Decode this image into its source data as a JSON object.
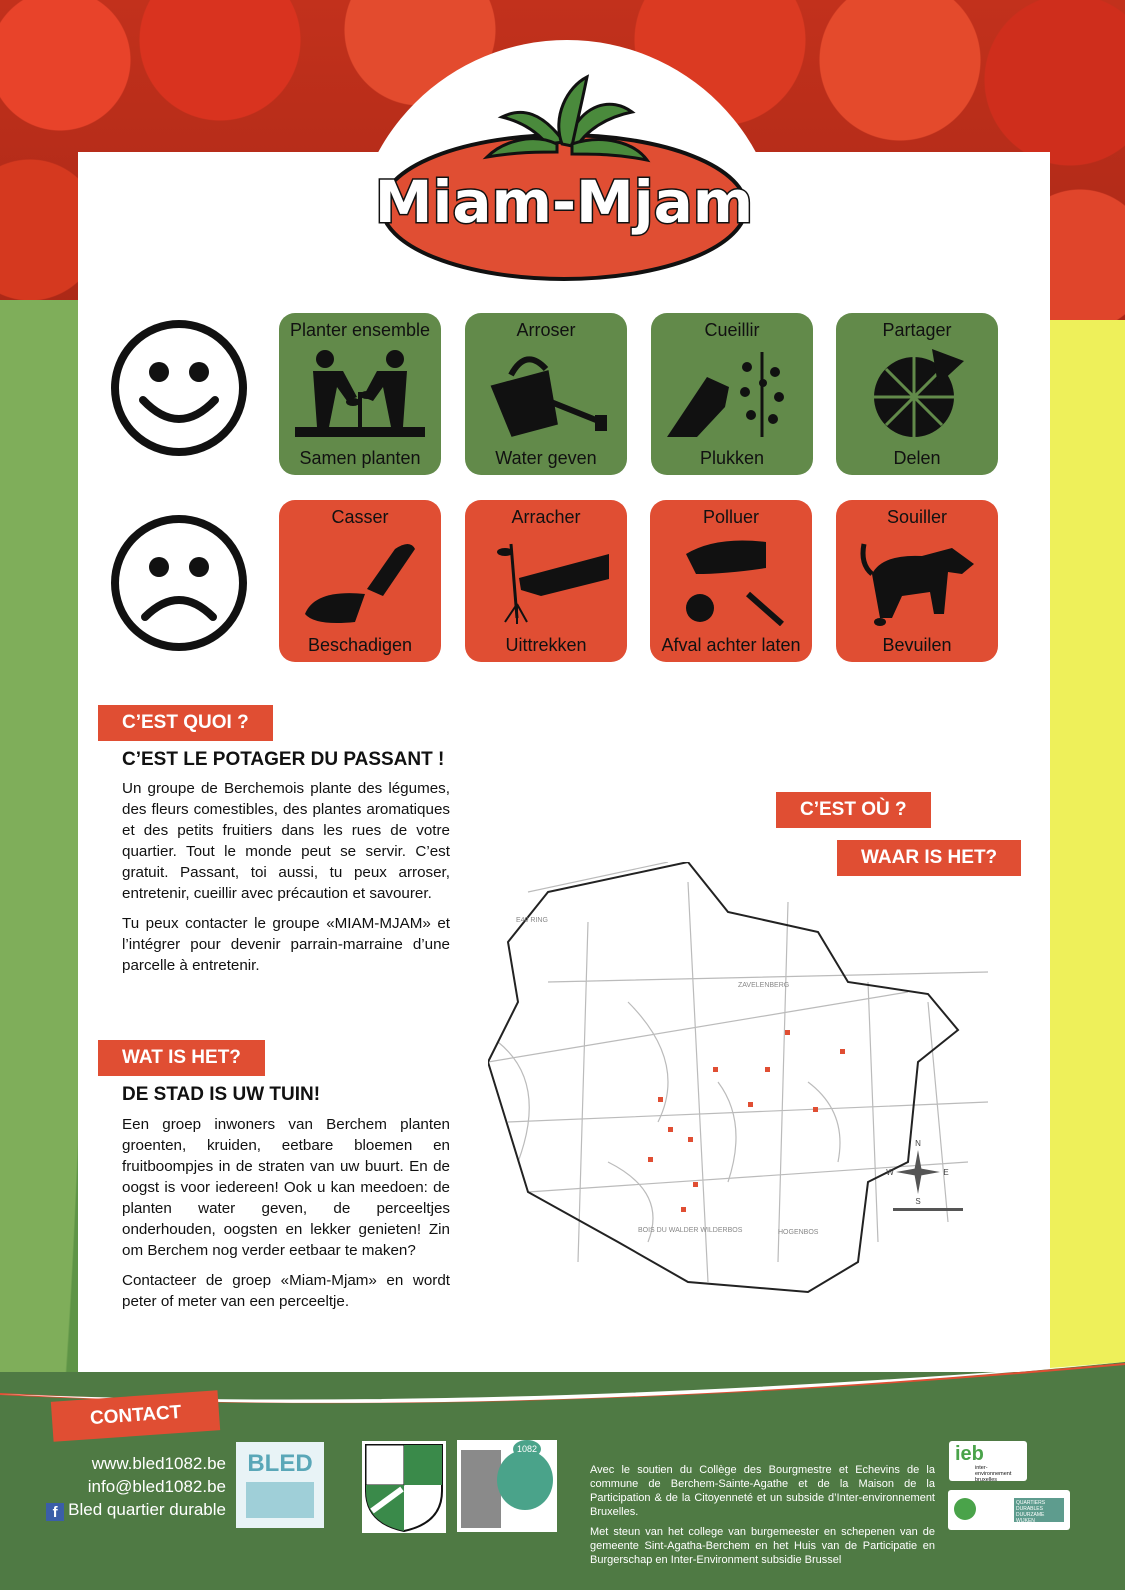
{
  "logo": {
    "text": "Miam-Mjam"
  },
  "do_row": [
    {
      "top": "Planter ensemble",
      "bottom": "Samen planten",
      "icon": "planting-icon"
    },
    {
      "top": "Arroser",
      "bottom": "Water geven",
      "icon": "watering-can-icon"
    },
    {
      "top": "Cueillir",
      "bottom": "Plukken",
      "icon": "picking-icon"
    },
    {
      "top": "Partager",
      "bottom": "Delen",
      "icon": "pizza-icon"
    }
  ],
  "dont_row": [
    {
      "top": "Casser",
      "bottom": "Beschadigen",
      "icon": "broken-zucchini-icon"
    },
    {
      "top": "Arracher",
      "bottom": "Uittrekken",
      "icon": "uprooting-icon"
    },
    {
      "top": "Polluer",
      "bottom": "Afval achter laten",
      "icon": "littering-icon"
    },
    {
      "top": "Souiller",
      "bottom": "Bevuilen",
      "icon": "dog-fouling-icon"
    }
  ],
  "fr": {
    "tag": "C’EST QUOI ?",
    "title": "C’EST LE POTAGER DU PASSANT !",
    "p1": "Un groupe de Berchemois plante des légumes, des fleurs comestibles, des plantes aromatiques et des petits fruitiers dans les rues de votre quartier. Tout le monde peut se servir. C’est gratuit. Passant, toi aussi, tu peux arroser, entretenir, cueillir avec précaution et savourer.",
    "p2": "Tu peux contacter le groupe «MIAM-MJAM» et l’intégrer pour devenir parrain-marraine d’une parcelle à entretenir."
  },
  "nl": {
    "tag": "WAT IS HET?",
    "title": "DE STAD IS UW TUIN!",
    "p1": "Een groep inwoners van Berchem planten groenten, kruiden, eetbare bloemen en fruitboompjes in de straten van uw buurt. En de oogst is voor iedereen! Ook u kan meedoen: de planten water geven, de perceeltjes onderhouden, oogsten en lekker genieten! Zin om Berchem nog verder eetbaar te maken?",
    "p2": "Contacteer de groep «Miam-Mjam» en wordt peter of meter van een perceeltje."
  },
  "where": {
    "fr": "C’EST OÙ ?",
    "nl": "WAAR IS HET?"
  },
  "map_labels": {
    "e40": "E40 RING",
    "zavelenberg": "ZAVELENBERG",
    "bois": "BOIS DU WALDER WILDERBOS",
    "hogenbos": "HOGENBOS",
    "compass_n": "N",
    "compass_s": "S",
    "compass_e": "E",
    "compass_w": "W"
  },
  "footer": {
    "contact_tag": "CONTACT",
    "web": "www.bled1082.be",
    "email": "info@bled1082.be",
    "facebook": "Bled quartier durable",
    "bled_logo": "BLED",
    "maison_badge": "1082",
    "sponsor_fr": "Avec le soutien du Collège des Bourgmestre et Echevins de la commune de Berchem-Sainte-Agathe et de la Maison de la Participation & de la Citoyenneté et un subside d’Inter-environnement Bruxelles.",
    "sponsor_nl": "Met steun van het college van burgemeester en schepenen van de gemeente Sint-Agatha-Berchem en het Huis van de Participatie en Burgerschap en Inter-Environment subsidie Brussel",
    "ieb_logo": "ieb",
    "ieb_sub": "inter-environnement bruxelles",
    "quartiers": "QUARTIERS DURABLES DUURZAME WIJKEN"
  },
  "colors": {
    "green": "#628a4a",
    "red": "#e04e33",
    "footer_green": "#4f7a44"
  }
}
